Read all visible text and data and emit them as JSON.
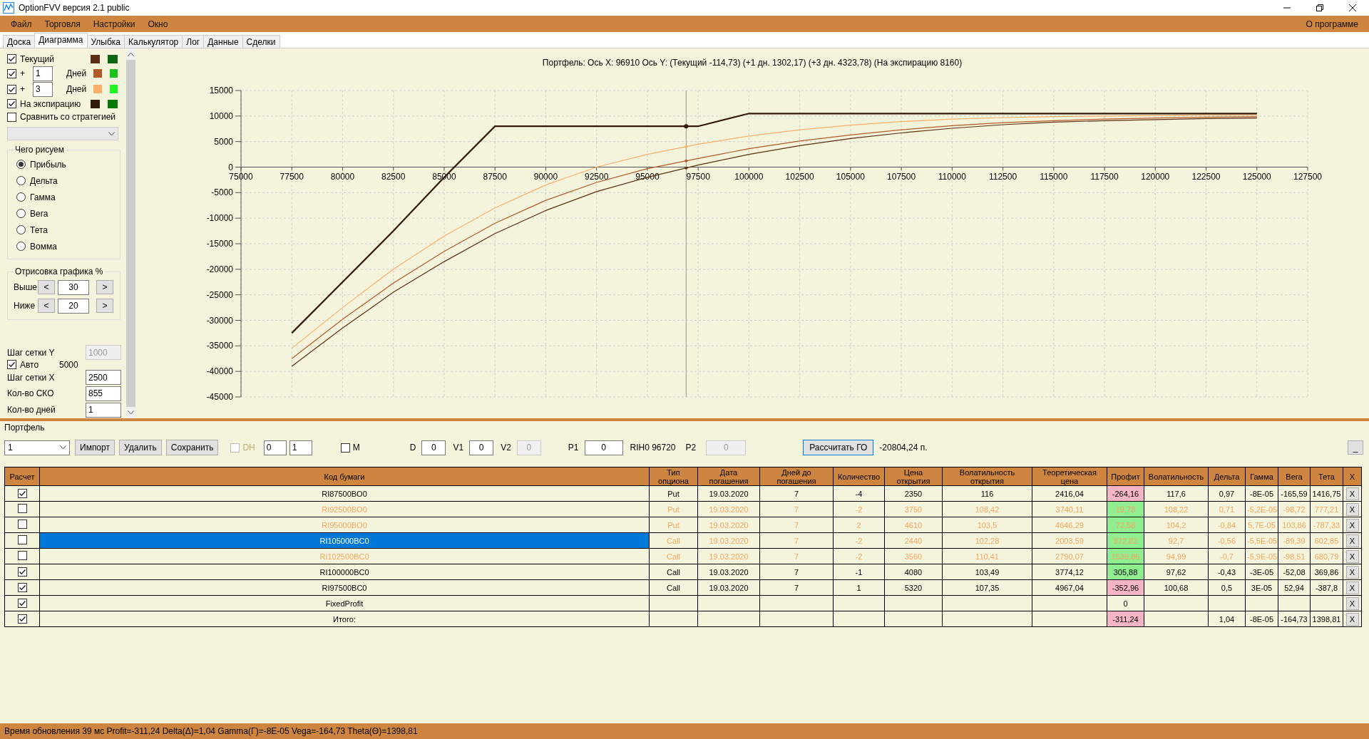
{
  "window": {
    "title": "OptionFVV версия 2.1 public"
  },
  "menu": {
    "items": [
      "Файл",
      "Торговля",
      "Настройки",
      "Окно"
    ],
    "right_item": "О программе"
  },
  "tabs": [
    {
      "label": "Доска",
      "selected": false
    },
    {
      "label": "Диаграмма",
      "selected": true
    },
    {
      "label": "Улыбка",
      "selected": false
    },
    {
      "label": "Калькулятор",
      "selected": false
    },
    {
      "label": "Лог",
      "selected": false
    },
    {
      "label": "Данные",
      "selected": false
    },
    {
      "label": "Сделки",
      "selected": false
    }
  ],
  "chart_settings": {
    "series_options": [
      {
        "kind": "plain",
        "checked": true,
        "label": "Текущий",
        "swatches": [
          {
            "color": "#5c2e14"
          },
          {
            "color": "#0d6612"
          }
        ]
      },
      {
        "kind": "days",
        "checked": true,
        "sign": "+",
        "days": "1",
        "unit": "Дней",
        "swatches": [
          {
            "color": "#b25b28"
          },
          {
            "color": "#18c21c"
          }
        ]
      },
      {
        "kind": "days",
        "checked": true,
        "sign": "+",
        "days": "3",
        "unit": "Дней",
        "swatches": [
          {
            "color": "#fdb06a"
          },
          {
            "color": "#22f526"
          }
        ]
      },
      {
        "kind": "plain",
        "checked": true,
        "label": "На экспирацию",
        "swatches": [
          {
            "color": "#33190a"
          },
          {
            "color": "#077a0a"
          }
        ]
      }
    ],
    "compare": {
      "checked": false,
      "label": "Сравнить со стратегией"
    },
    "strategy_select": {
      "disabled": true
    },
    "plot_group": {
      "title": "Чего рисуем",
      "options": [
        {
          "label": "Прибыль",
          "selected": true
        },
        {
          "label": "Дельта",
          "selected": false
        },
        {
          "label": "Гамма",
          "selected": false
        },
        {
          "label": "Вега",
          "selected": false
        },
        {
          "label": "Тета",
          "selected": false
        },
        {
          "label": "Вомма",
          "selected": false
        }
      ]
    },
    "range_group": {
      "title": "Отрисовка графика %",
      "rows": [
        {
          "label": "Выше",
          "decrease": "<",
          "value": "30",
          "increase": ">"
        },
        {
          "label": "Ниже",
          "decrease": "<",
          "value": "20",
          "increase": ">"
        }
      ]
    },
    "grid_y": {
      "label": "Шаг сетки Y",
      "value": "1000",
      "disabled": true
    },
    "auto": {
      "checked": true,
      "label": "Авто",
      "value": "5000"
    },
    "grid_x": {
      "label": "Шаг сетки X",
      "value": "2500"
    },
    "sko": {
      "label": "Кол-во СКО",
      "value": "855"
    },
    "days_count": {
      "label": "Кол-во дней",
      "value": "1"
    }
  },
  "chart": {
    "chart_data": {
      "type": "line",
      "title": "Портфель: Ось X: 96910 Ось Y:  (Текущий -114,73)  (+1 дн. 1302,17)  (+3 дн. 4323,78)  (На экспирацию 8160)",
      "x": [
        77500,
        80000,
        82500,
        85000,
        87500,
        90000,
        92500,
        95000,
        97500,
        100000,
        102500,
        105000,
        107500,
        110000,
        112500,
        115000,
        117500,
        120000,
        122500,
        125000
      ],
      "series": [
        {
          "color": "#5c2e14",
          "values": [
            -39000,
            -31500,
            -24500,
            -18500,
            -13000,
            -8500,
            -4800,
            -2000,
            400,
            2500,
            4200,
            5600,
            6700,
            7600,
            8300,
            8800,
            9100,
            9300,
            9500,
            9600
          ]
        },
        {
          "color": "#b25b28",
          "values": [
            -37500,
            -29800,
            -22700,
            -16500,
            -11000,
            -6500,
            -3000,
            -300,
            1700,
            3600,
            5100,
            6300,
            7300,
            8100,
            8700,
            9100,
            9400,
            9600,
            9800,
            9900
          ]
        },
        {
          "color": "#fdb06a",
          "values": [
            -35500,
            -27500,
            -20000,
            -13500,
            -8000,
            -3500,
            0,
            2500,
            4500,
            6100,
            7300,
            8200,
            8900,
            9400,
            9700,
            9900,
            10000,
            10100,
            10200,
            10200
          ]
        },
        {
          "color": "#33190a",
          "values": [
            -32500,
            -22500,
            -12500,
            -2000,
            8000,
            8000,
            8000,
            8000,
            8000,
            10500,
            10500,
            10500,
            10500,
            10500,
            10500,
            10500,
            10500,
            10500,
            10500,
            10500
          ]
        }
      ],
      "grid": true,
      "xlim": [
        75000,
        127500
      ],
      "ylim": [
        -45000,
        15000
      ],
      "xticks": [
        75000,
        77500,
        80000,
        82500,
        85000,
        87500,
        90000,
        92500,
        95000,
        97500,
        100000,
        102500,
        105000,
        107500,
        110000,
        112500,
        115000,
        117500,
        120000,
        122500,
        125000,
        127500
      ],
      "yticks": [
        -45000,
        -40000,
        -35000,
        -30000,
        -25000,
        -20000,
        -15000,
        -10000,
        -5000,
        0,
        5000,
        10000,
        15000
      ],
      "ref_lines": [
        {
          "axis": "x",
          "value": 96910
        }
      ]
    }
  },
  "portfolio": {
    "title": "Портфель",
    "select_value": "1",
    "buttons": [
      "Импорт",
      "Удалить",
      "Сохранить"
    ],
    "dh": {
      "label": "DH",
      "checked": false,
      "disabled": true
    },
    "spinners": [
      "0",
      "1"
    ],
    "m": {
      "label": "M",
      "checked": false
    },
    "fields": [
      {
        "label": "D",
        "value": "0",
        "disabled": false
      },
      {
        "label": "V1",
        "value": "0",
        "disabled": false
      },
      {
        "label": "V2",
        "value": "0",
        "disabled": true
      },
      {
        "label": "P1",
        "value": "0",
        "disabled": false
      }
    ],
    "quote": "RIH0 96720",
    "p2": {
      "label": "P2",
      "value": "0",
      "disabled": true
    },
    "calc_button": "Рассчитать ГО",
    "margin": "-20804,24 п.",
    "collapse_button": "_",
    "table": {
      "columns": [
        "Расчет",
        "Код бумаги",
        "Тип опциона",
        "Дата погашения",
        "Дней до погашения",
        "Количество",
        "Цена открытия",
        "Волатильность открытия",
        "Теоретическая цена",
        "Профит",
        "Волатильность",
        "Дельта",
        "Гамма",
        "Вега",
        "Тета",
        "X"
      ],
      "rows": [
        {
          "checked": true,
          "selected": false,
          "code": "RI87500BO0",
          "type": "Put",
          "date": "19.03.2020",
          "days": "7",
          "qty": "-4",
          "open_price": "2350",
          "open_vol": "116",
          "theor": "2416,04",
          "profit": "-264,16",
          "color": "#f5b5c5",
          "vol": "117,6",
          "delta": "0,97",
          "gamma": "-8E-05",
          "vega": "-165,59",
          "theta": "1416,75",
          "remove": "X"
        },
        {
          "checked": false,
          "selected": false,
          "code": "RI92500BO0",
          "type": "Put",
          "date": "19.03.2020",
          "days": "7",
          "qty": "-2",
          "open_price": "3750",
          "open_vol": "108,42",
          "theor": "3740,11",
          "profit": "19,78",
          "color": "#90ee90",
          "vol": "108,22",
          "delta": "0,71",
          "gamma": "-5,2E-05",
          "vega": "-98,72",
          "theta": "777,21",
          "remove": "X"
        },
        {
          "checked": false,
          "selected": false,
          "code": "RI95000BO0",
          "type": "Put",
          "date": "19.03.2020",
          "days": "7",
          "qty": "2",
          "open_price": "4610",
          "open_vol": "103,5",
          "theor": "4646,29",
          "profit": "72,58",
          "color": "#90ee90",
          "vol": "104,2",
          "delta": "-0,84",
          "gamma": "5,7E-05",
          "vega": "103,86",
          "theta": "-787,33",
          "remove": "X"
        },
        {
          "checked": false,
          "selected": true,
          "code": "RI105000BC0",
          "type": "Call",
          "date": "19.03.2020",
          "days": "7",
          "qty": "-2",
          "open_price": "2440",
          "open_vol": "102,28",
          "theor": "2003,59",
          "profit": "872,82",
          "color": "#90ee90",
          "vol": "92,7",
          "delta": "-0,56",
          "gamma": "-5,5E-05",
          "vega": "-89,39",
          "theta": "602,85",
          "remove": "X"
        },
        {
          "checked": false,
          "selected": false,
          "code": "RI102500BC0",
          "type": "Call",
          "date": "19.03.2020",
          "days": "7",
          "qty": "-2",
          "open_price": "3560",
          "open_vol": "110,41",
          "theor": "2790,07",
          "profit": "1539,86",
          "color": "#90ee90",
          "vol": "94,99",
          "delta": "-0,7",
          "gamma": "-5,9E-05",
          "vega": "-98,51",
          "theta": "680,79",
          "remove": "X"
        },
        {
          "checked": true,
          "selected": false,
          "code": "RI100000BC0",
          "type": "Call",
          "date": "19.03.2020",
          "days": "7",
          "qty": "-1",
          "open_price": "4080",
          "open_vol": "103,49",
          "theor": "3774,12",
          "profit": "305,88",
          "color": "#90ee90",
          "vol": "97,62",
          "delta": "-0,43",
          "gamma": "-3E-05",
          "vega": "-52,08",
          "theta": "369,86",
          "remove": "X"
        },
        {
          "checked": true,
          "selected": false,
          "code": "RI97500BC0",
          "type": "Call",
          "date": "19.03.2020",
          "days": "7",
          "qty": "1",
          "open_price": "5320",
          "open_vol": "107,35",
          "theor": "4967,04",
          "profit": "-352,96",
          "color": "#f5b5c5",
          "vol": "100,68",
          "delta": "0,5",
          "gamma": "3E-05",
          "vega": "52,94",
          "theta": "-387,8",
          "remove": "X"
        },
        {
          "checked": true,
          "selected": false,
          "code": "FixedProfit",
          "profit": "0",
          "remove": "X"
        },
        {
          "checked": true,
          "selected": false,
          "code": "Итого:",
          "profit": "-311,24",
          "color": "#f5b5c5",
          "delta": "1,04",
          "gamma": "-8E-05",
          "vega": "-164,73",
          "theta": "1398,81",
          "remove": "X"
        }
      ]
    }
  },
  "status_bar": {
    "text": "Время обновления 39 мс  Profit=-311,24 Delta(Δ)=1,04 Gamma(Γ)=-8E-05 Vega=-164,73 Theta(Θ)=1398,81"
  }
}
